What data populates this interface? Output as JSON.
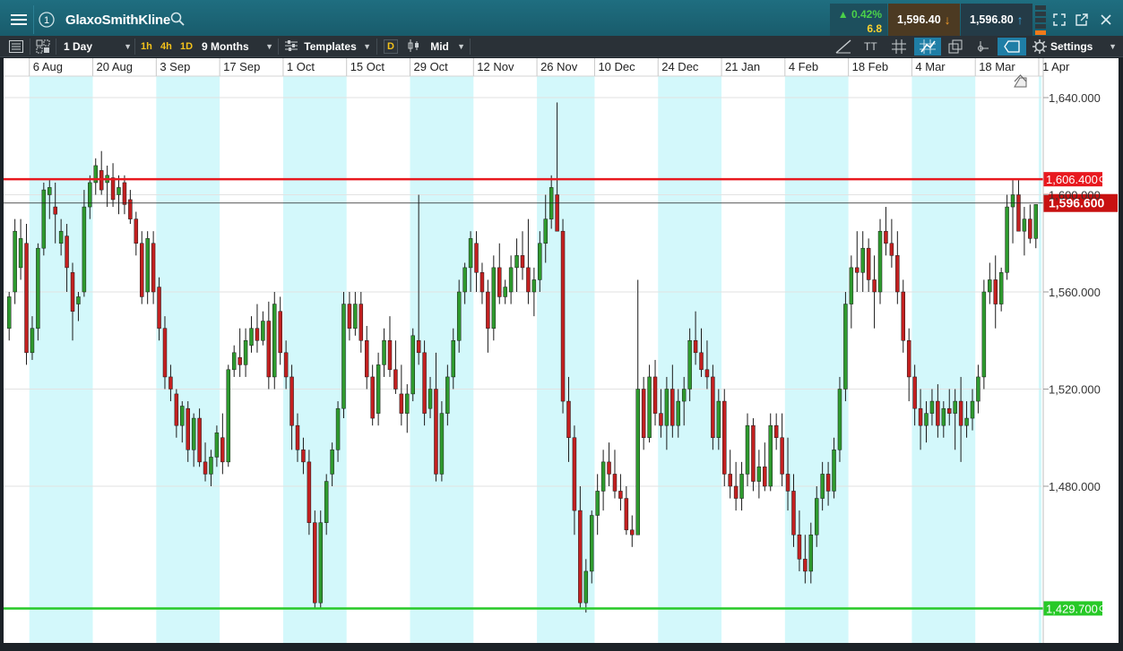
{
  "app": {
    "title": "GlaxoSmithKline",
    "change_pct": "0.42%",
    "change_abs": "6.8",
    "sell_price": "1,596.40",
    "buy_price": "1,596.80",
    "info_badge": "1"
  },
  "toolbar": {
    "interval": "1 Day",
    "quick_1h": "1h",
    "quick_4h": "4h",
    "quick_1d": "1D",
    "period": "9 Months",
    "templates": "Templates",
    "d_button": "D",
    "price_type": "Mid",
    "text_tool": "TT",
    "settings": "Settings"
  },
  "icons": {
    "menu": "hamburger-icon",
    "info": "info-circle-icon",
    "search": "search-icon",
    "list": "list-icon",
    "layout": "layout-grid-icon",
    "templates": "sliders-icon",
    "candle": "candlestick-icon",
    "draw": "pencil-line-icon",
    "grid": "grid-icon",
    "annotate": "indicator-icon",
    "windows": "stacked-windows-icon",
    "tag": "tag-icon",
    "gear": "gear-icon",
    "popout": "popout-icon",
    "expand": "expand-icon",
    "close": "close-icon"
  },
  "colors": {
    "up": "#2e9a2e",
    "down": "#c22020",
    "resistance": "#e8191f",
    "support": "#27c927",
    "band": "#d3f8fb",
    "current": "#c81111"
  },
  "chart_data": {
    "type": "candlestick",
    "title": "",
    "y_ticks": [
      "1,640.000",
      "1,600.000",
      "1,560.000",
      "1,520.000",
      "1,480.000"
    ],
    "y_tick_values": [
      1640,
      1600,
      1560,
      1520,
      1480
    ],
    "ylim": [
      1410,
      1650
    ],
    "x_tick_labels": [
      "6 Aug",
      "20 Aug",
      "3 Sep",
      "17 Sep",
      "1 Oct",
      "15 Oct",
      "29 Oct",
      "12 Nov",
      "26 Nov",
      "10 Dec",
      "24 Dec",
      "21 Jan",
      "4 Feb",
      "18 Feb",
      "4 Mar",
      "18 Mar",
      "1 Apr"
    ],
    "horizontal_lines": [
      {
        "label": "1,606.400",
        "value": 1606.4,
        "color": "#e8191f"
      },
      {
        "label": "1,429.700",
        "value": 1429.7,
        "color": "#27c927"
      }
    ],
    "current_price": {
      "label": "1,596.600",
      "value": 1596.6
    },
    "candles_ohlc": [
      [
        1545,
        1560,
        1540,
        1558
      ],
      [
        1560,
        1590,
        1555,
        1585
      ],
      [
        1570,
        1590,
        1565,
        1582
      ],
      [
        1580,
        1588,
        1530,
        1535
      ],
      [
        1535,
        1550,
        1532,
        1545
      ],
      [
        1545,
        1580,
        1540,
        1578
      ],
      [
        1578,
        1605,
        1575,
        1602
      ],
      [
        1600,
        1606,
        1590,
        1603
      ],
      [
        1595,
        1605,
        1580,
        1592
      ],
      [
        1580,
        1590,
        1575,
        1585
      ],
      [
        1583,
        1588,
        1560,
        1570
      ],
      [
        1568,
        1572,
        1540,
        1552
      ],
      [
        1555,
        1560,
        1548,
        1558
      ],
      [
        1560,
        1602,
        1558,
        1595
      ],
      [
        1595,
        1608,
        1590,
        1605
      ],
      [
        1605,
        1615,
        1600,
        1612
      ],
      [
        1610,
        1618,
        1600,
        1602
      ],
      [
        1605,
        1612,
        1595,
        1608
      ],
      [
        1607,
        1613,
        1595,
        1598
      ],
      [
        1600,
        1608,
        1592,
        1603
      ],
      [
        1605,
        1608,
        1592,
        1596
      ],
      [
        1598,
        1602,
        1588,
        1590
      ],
      [
        1590,
        1593,
        1575,
        1580
      ],
      [
        1580,
        1585,
        1555,
        1558
      ],
      [
        1560,
        1585,
        1555,
        1582
      ],
      [
        1580,
        1585,
        1555,
        1560
      ],
      [
        1562,
        1566,
        1540,
        1545
      ],
      [
        1545,
        1550,
        1520,
        1525
      ],
      [
        1525,
        1530,
        1515,
        1520
      ],
      [
        1518,
        1520,
        1500,
        1505
      ],
      [
        1505,
        1515,
        1498,
        1513
      ],
      [
        1512,
        1515,
        1490,
        1495
      ],
      [
        1495,
        1510,
        1488,
        1508
      ],
      [
        1508,
        1512,
        1488,
        1490
      ],
      [
        1490,
        1498,
        1482,
        1485
      ],
      [
        1485,
        1495,
        1480,
        1492
      ],
      [
        1492,
        1505,
        1488,
        1502
      ],
      [
        1500,
        1510,
        1485,
        1490
      ],
      [
        1490,
        1530,
        1488,
        1528
      ],
      [
        1528,
        1538,
        1525,
        1535
      ],
      [
        1533,
        1545,
        1525,
        1530
      ],
      [
        1530,
        1545,
        1525,
        1540
      ],
      [
        1538,
        1550,
        1535,
        1545
      ],
      [
        1545,
        1555,
        1535,
        1540
      ],
      [
        1540,
        1552,
        1538,
        1548
      ],
      [
        1548,
        1556,
        1520,
        1525
      ],
      [
        1525,
        1560,
        1520,
        1555
      ],
      [
        1552,
        1558,
        1530,
        1535
      ],
      [
        1535,
        1540,
        1520,
        1525
      ],
      [
        1525,
        1530,
        1495,
        1505
      ],
      [
        1505,
        1510,
        1490,
        1495
      ],
      [
        1495,
        1500,
        1485,
        1490
      ],
      [
        1490,
        1495,
        1460,
        1465
      ],
      [
        1465,
        1470,
        1430,
        1432
      ],
      [
        1432,
        1470,
        1430,
        1465
      ],
      [
        1465,
        1485,
        1460,
        1482
      ],
      [
        1485,
        1498,
        1480,
        1495
      ],
      [
        1495,
        1515,
        1490,
        1512
      ],
      [
        1512,
        1560,
        1508,
        1555
      ],
      [
        1555,
        1560,
        1540,
        1545
      ],
      [
        1545,
        1560,
        1542,
        1555
      ],
      [
        1555,
        1560,
        1535,
        1540
      ],
      [
        1540,
        1546,
        1520,
        1525
      ],
      [
        1525,
        1530,
        1505,
        1508
      ],
      [
        1510,
        1535,
        1505,
        1530
      ],
      [
        1530,
        1545,
        1525,
        1540
      ],
      [
        1540,
        1550,
        1525,
        1528
      ],
      [
        1528,
        1540,
        1518,
        1520
      ],
      [
        1518,
        1530,
        1505,
        1510
      ],
      [
        1510,
        1522,
        1502,
        1518
      ],
      [
        1518,
        1545,
        1515,
        1542
      ],
      [
        1540,
        1600,
        1530,
        1535
      ],
      [
        1535,
        1540,
        1505,
        1510
      ],
      [
        1512,
        1525,
        1508,
        1520
      ],
      [
        1520,
        1535,
        1482,
        1485
      ],
      [
        1485,
        1515,
        1482,
        1510
      ],
      [
        1510,
        1530,
        1505,
        1525
      ],
      [
        1525,
        1545,
        1520,
        1540
      ],
      [
        1540,
        1565,
        1535,
        1560
      ],
      [
        1560,
        1572,
        1555,
        1570
      ],
      [
        1570,
        1585,
        1560,
        1582
      ],
      [
        1580,
        1585,
        1560,
        1568
      ],
      [
        1568,
        1572,
        1555,
        1560
      ],
      [
        1560,
        1565,
        1535,
        1545
      ],
      [
        1545,
        1575,
        1540,
        1570
      ],
      [
        1570,
        1580,
        1555,
        1558
      ],
      [
        1558,
        1565,
        1555,
        1562
      ],
      [
        1560,
        1575,
        1555,
        1570
      ],
      [
        1570,
        1582,
        1560,
        1575
      ],
      [
        1575,
        1585,
        1565,
        1570
      ],
      [
        1570,
        1590,
        1555,
        1560
      ],
      [
        1560,
        1570,
        1550,
        1565
      ],
      [
        1565,
        1585,
        1560,
        1580
      ],
      [
        1580,
        1600,
        1572,
        1590
      ],
      [
        1590,
        1608,
        1586,
        1603
      ],
      [
        1600,
        1638,
        1595,
        1585
      ],
      [
        1585,
        1590,
        1510,
        1515
      ],
      [
        1515,
        1525,
        1490,
        1500
      ],
      [
        1500,
        1505,
        1460,
        1470
      ],
      [
        1470,
        1480,
        1430,
        1432
      ],
      [
        1432,
        1450,
        1428,
        1445
      ],
      [
        1445,
        1470,
        1440,
        1468
      ],
      [
        1468,
        1485,
        1460,
        1478
      ],
      [
        1478,
        1495,
        1470,
        1490
      ],
      [
        1490,
        1498,
        1480,
        1485
      ],
      [
        1485,
        1495,
        1475,
        1478
      ],
      [
        1478,
        1485,
        1470,
        1475
      ],
      [
        1475,
        1480,
        1460,
        1462
      ],
      [
        1462,
        1468,
        1455,
        1460
      ],
      [
        1460,
        1565,
        1470,
        1520
      ],
      [
        1520,
        1525,
        1495,
        1500
      ],
      [
        1500,
        1530,
        1498,
        1525
      ],
      [
        1525,
        1532,
        1505,
        1510
      ],
      [
        1510,
        1520,
        1500,
        1505
      ],
      [
        1505,
        1525,
        1495,
        1520
      ],
      [
        1520,
        1530,
        1500,
        1505
      ],
      [
        1505,
        1520,
        1500,
        1515
      ],
      [
        1515,
        1525,
        1505,
        1520
      ],
      [
        1520,
        1545,
        1515,
        1540
      ],
      [
        1540,
        1552,
        1530,
        1535
      ],
      [
        1535,
        1545,
        1525,
        1528
      ],
      [
        1528,
        1540,
        1520,
        1525
      ],
      [
        1525,
        1530,
        1495,
        1500
      ],
      [
        1500,
        1520,
        1495,
        1515
      ],
      [
        1515,
        1520,
        1480,
        1485
      ],
      [
        1485,
        1495,
        1475,
        1480
      ],
      [
        1480,
        1490,
        1470,
        1475
      ],
      [
        1475,
        1490,
        1470,
        1485
      ],
      [
        1485,
        1510,
        1480,
        1505
      ],
      [
        1505,
        1508,
        1478,
        1482
      ],
      [
        1482,
        1495,
        1475,
        1488
      ],
      [
        1488,
        1498,
        1478,
        1480
      ],
      [
        1480,
        1510,
        1478,
        1505
      ],
      [
        1505,
        1510,
        1495,
        1500
      ],
      [
        1500,
        1510,
        1480,
        1485
      ],
      [
        1485,
        1500,
        1470,
        1478
      ],
      [
        1478,
        1485,
        1455,
        1460
      ],
      [
        1460,
        1470,
        1445,
        1450
      ],
      [
        1450,
        1460,
        1440,
        1445
      ],
      [
        1445,
        1465,
        1440,
        1460
      ],
      [
        1460,
        1480,
        1455,
        1475
      ],
      [
        1475,
        1490,
        1470,
        1485
      ],
      [
        1485,
        1490,
        1472,
        1478
      ],
      [
        1478,
        1500,
        1475,
        1495
      ],
      [
        1495,
        1525,
        1490,
        1520
      ],
      [
        1520,
        1560,
        1515,
        1555
      ],
      [
        1555,
        1575,
        1545,
        1570
      ],
      [
        1570,
        1585,
        1560,
        1568
      ],
      [
        1568,
        1585,
        1560,
        1578
      ],
      [
        1578,
        1582,
        1560,
        1565
      ],
      [
        1565,
        1575,
        1545,
        1560
      ],
      [
        1560,
        1590,
        1555,
        1585
      ],
      [
        1585,
        1595,
        1575,
        1580
      ],
      [
        1580,
        1590,
        1570,
        1575
      ],
      [
        1575,
        1585,
        1555,
        1560
      ],
      [
        1560,
        1565,
        1535,
        1540
      ],
      [
        1540,
        1545,
        1515,
        1525
      ],
      [
        1525,
        1530,
        1505,
        1512
      ],
      [
        1512,
        1520,
        1495,
        1505
      ],
      [
        1505,
        1515,
        1498,
        1510
      ],
      [
        1510,
        1520,
        1505,
        1515
      ],
      [
        1515,
        1522,
        1500,
        1505
      ],
      [
        1505,
        1515,
        1500,
        1512
      ],
      [
        1512,
        1520,
        1505,
        1510
      ],
      [
        1510,
        1520,
        1495,
        1515
      ],
      [
        1515,
        1525,
        1490,
        1505
      ],
      [
        1505,
        1515,
        1500,
        1508
      ],
      [
        1508,
        1520,
        1503,
        1515
      ],
      [
        1515,
        1530,
        1510,
        1525
      ],
      [
        1525,
        1565,
        1520,
        1560
      ],
      [
        1560,
        1572,
        1555,
        1565
      ],
      [
        1565,
        1575,
        1545,
        1555
      ],
      [
        1555,
        1570,
        1552,
        1568
      ],
      [
        1568,
        1600,
        1565,
        1595
      ],
      [
        1595,
        1606,
        1580,
        1600
      ],
      [
        1600,
        1606,
        1590,
        1585
      ],
      [
        1585,
        1595,
        1575,
        1590
      ],
      [
        1590,
        1596,
        1580,
        1582
      ],
      [
        1582,
        1595,
        1578,
        1596
      ]
    ]
  }
}
